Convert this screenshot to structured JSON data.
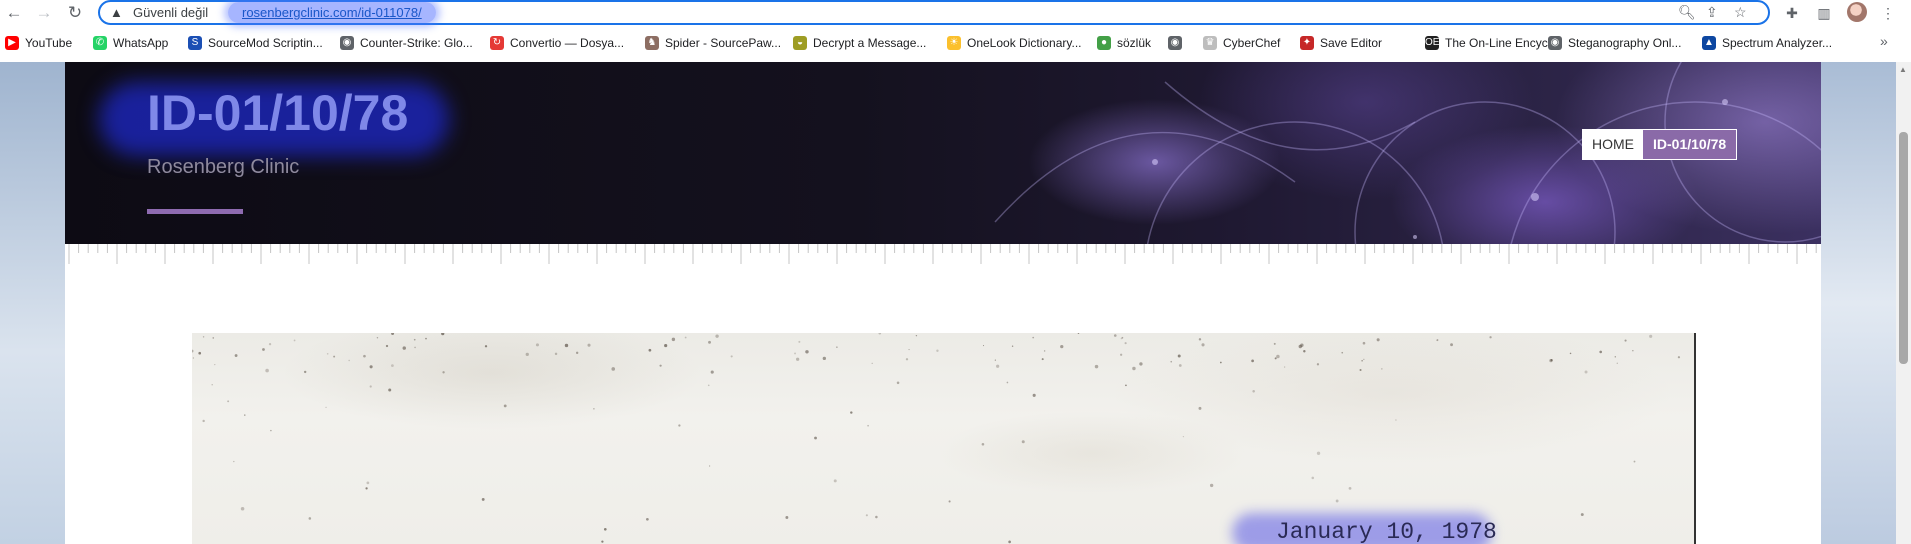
{
  "browser": {
    "security_label": "Güvenli değil",
    "url": "rosenbergclinic.com/id-011078/",
    "nav": {
      "back": "←",
      "forward": "→",
      "reload": "↻"
    },
    "omnibox_icons": {
      "zoom": "🔍︎",
      "share": "⇪",
      "bookmark": "☆"
    },
    "toolbar_icons": {
      "extensions": "✚",
      "side_panel": "▥",
      "menu": "⋮"
    }
  },
  "bookmarks": [
    {
      "label": "YouTube",
      "color": "#ff0000",
      "glyph": "▶"
    },
    {
      "label": "WhatsApp",
      "color": "#25d366",
      "glyph": "✆"
    },
    {
      "label": "SourceMod Scriptin...",
      "color": "#1b4fb4",
      "glyph": "S"
    },
    {
      "label": "Counter-Strike: Glo...",
      "color": "#5f6368",
      "glyph": "◉"
    },
    {
      "label": "Convertio — Dosya...",
      "color": "#e53935",
      "glyph": "↻"
    },
    {
      "label": "Spider - SourcePaw...",
      "color": "#8d6e63",
      "glyph": "♞"
    },
    {
      "label": "Decrypt a Message...",
      "color": "#9e9d24",
      "glyph": "◒"
    },
    {
      "label": "OneLook Dictionary...",
      "color": "#fbc02d",
      "glyph": "☀"
    },
    {
      "label": "sözlük",
      "color": "#43a047",
      "glyph": "●"
    },
    {
      "label": "",
      "color": "#5f6368",
      "glyph": "◉"
    },
    {
      "label": "CyberChef",
      "color": "#bdbdbd",
      "glyph": "♛"
    },
    {
      "label": "Save Editor",
      "color": "#c62828",
      "glyph": "✦"
    },
    {
      "label": "The On-Line Encycl...",
      "color": "#212121",
      "glyph": "OE"
    },
    {
      "label": "Steganography Onl...",
      "color": "#5f6368",
      "glyph": "◉"
    },
    {
      "label": "Spectrum Analyzer...",
      "color": "#0d47a1",
      "glyph": "▲"
    }
  ],
  "bookmarks_overflow": "»",
  "site": {
    "title": "ID-01/10/78",
    "subtitle": "Rosenberg Clinic"
  },
  "breadcrumb": {
    "home": "HOME",
    "current": "ID-01/10/78"
  },
  "document": {
    "date": "January 10, 1978"
  },
  "scrollbar": {
    "up_arrow": "▲"
  }
}
